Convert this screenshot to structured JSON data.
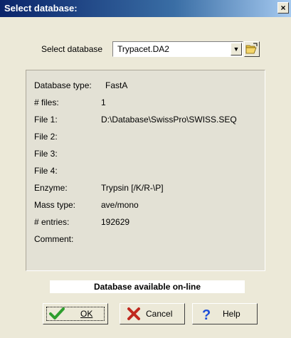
{
  "window": {
    "title": "Select database:",
    "close_label": "×"
  },
  "select": {
    "label": "Select database",
    "value": "Trypacet.DA2"
  },
  "info": {
    "rows": [
      {
        "label": "Database type:",
        "value": "FastA"
      },
      {
        "label": "# files:",
        "value": "1"
      },
      {
        "label": "File 1:",
        "value": "D:\\Database\\SwissPro\\SWISS.SEQ"
      },
      {
        "label": "File 2:",
        "value": ""
      },
      {
        "label": "File 3:",
        "value": ""
      },
      {
        "label": "File 4:",
        "value": ""
      },
      {
        "label": "Enzyme:",
        "value": "Trypsin [/K/R-\\P]"
      },
      {
        "label": "Mass type:",
        "value": "ave/mono"
      },
      {
        "label": "# entries:",
        "value": "192629"
      },
      {
        "label": "Comment:",
        "value": ""
      }
    ]
  },
  "status": {
    "text": "Database available on-line"
  },
  "buttons": {
    "ok_label": "OK",
    "cancel_label": "Cancel",
    "help_label": "Help"
  },
  "icons": {
    "ok": "checkmark-icon",
    "cancel": "x-icon",
    "help": "question-mark-icon",
    "browse": "open-folder-icon",
    "dropdown": "chevron-down-icon"
  },
  "colors": {
    "titlebar_start": "#0a246a",
    "titlebar_end": "#a6caf0",
    "dialog_bg": "#ece9d8",
    "ok_icon": "#2e9e2e",
    "cancel_icon": "#c0281e",
    "help_icon": "#1f4fd8"
  }
}
